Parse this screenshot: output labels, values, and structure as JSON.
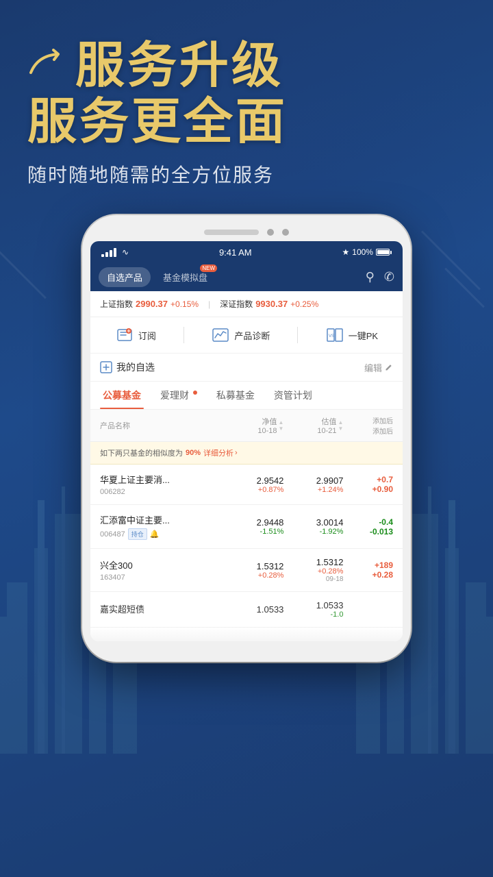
{
  "hero": {
    "title_row1": "服务升级",
    "title_row2": "服务更全面",
    "subtitle": "随时随地随需的全方位服务"
  },
  "status_bar": {
    "time": "9:41 AM",
    "battery_pct": "100%",
    "bluetooth": true
  },
  "nav": {
    "tab1": "自选产品",
    "tab2": "基金模拟盘",
    "tab2_badge": "NEW",
    "search_icon": "search-icon",
    "headset_icon": "headset-icon"
  },
  "index": {
    "sh_name": "上证指数",
    "sh_value": "2990.37",
    "sh_change": "+0.15%",
    "sz_name": "深证指数",
    "sz_value": "9930.37",
    "sz_change": "+0.25%"
  },
  "actions": {
    "subscribe": "订阅",
    "diagnose": "产品诊断",
    "pk": "一键PK"
  },
  "favorites": {
    "title": "我的自选",
    "edit": "编辑"
  },
  "categories": {
    "tab1": "公募基金",
    "tab2": "爱理财",
    "tab3": "私募基金",
    "tab4": "资管计划"
  },
  "table_header": {
    "name": "产品名称",
    "nav": "净值",
    "nav_date": "10-18",
    "est": "估值",
    "est_date": "10-21",
    "add": "添加后",
    "add2": "添加后"
  },
  "similarity": {
    "text": "如下两只基金的相似度为",
    "pct": "90%",
    "link": "详细分析"
  },
  "funds": [
    {
      "name": "华夏上证主要消...",
      "code": "006282",
      "nav_val": "2.9542",
      "nav_chg": "+0.87%",
      "est_val": "2.9907",
      "est_chg": "+1.24%",
      "add_val": "+0.7",
      "add_val2": "+0.90",
      "direction": "up"
    },
    {
      "name": "汇添富中证主要...",
      "code": "006487",
      "hold": true,
      "bell": true,
      "nav_val": "2.9448",
      "nav_chg": "-1.51%",
      "est_val": "3.0014",
      "est_chg": "-1.92%",
      "add_val": "-0.4",
      "add_val2": "-0.013",
      "direction": "down"
    },
    {
      "name": "兴全300",
      "code": "163407",
      "nav_val": "1.5312",
      "nav_chg": "+0.28%",
      "est_val": "1.5312",
      "est_chg": "+0.28%",
      "est_date": "09-18",
      "add_val": "+189",
      "add_val2": "+0.28",
      "direction": "up"
    },
    {
      "name": "嘉实超短债",
      "code": "",
      "nav_val": "1.0533",
      "nav_chg": "",
      "est_val": "1.0533",
      "est_chg": "-1.0",
      "add_val": "",
      "add_val2": "",
      "direction": "up"
    }
  ]
}
